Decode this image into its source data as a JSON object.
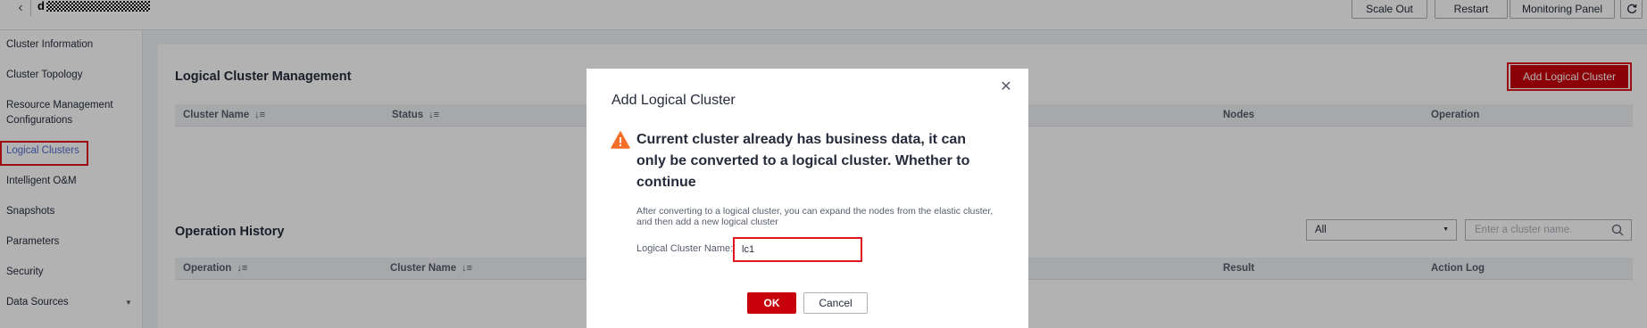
{
  "topbar": {
    "back_icon": "chevron-left-icon",
    "cluster_title_prefix": "d",
    "buttons": {
      "scale_out": "Scale Out",
      "restart": "Restart",
      "monitoring_panel": "Monitoring Panel",
      "refresh_icon": "refresh-icon"
    }
  },
  "sidebar": {
    "items": [
      {
        "label": "Cluster Information"
      },
      {
        "label": "Cluster Topology"
      },
      {
        "label": "Resource Management",
        "label2": "Configurations"
      },
      {
        "label": "Logical Clusters",
        "active": true
      },
      {
        "label": "Intelligent O&M"
      },
      {
        "label": "Snapshots"
      },
      {
        "label": "Parameters"
      },
      {
        "label": "Security"
      },
      {
        "label": "Data Sources",
        "expandable": true
      }
    ]
  },
  "main": {
    "logical_section": {
      "title": "Logical Cluster Management",
      "add_button": "Add Logical Cluster",
      "columns": [
        "Cluster Name",
        "Status",
        "Nodes",
        "Operation"
      ]
    },
    "history_section": {
      "title": "Operation History",
      "filter_selected": "All",
      "search_placeholder": "Enter a cluster name.",
      "columns": [
        "Operation",
        "Cluster Name",
        "Result",
        "Action Log"
      ]
    }
  },
  "dialog": {
    "title": "Add Logical Cluster",
    "warning": "Current cluster already has business data, it can only be converted to a logical cluster. Whether to continue",
    "description": "After converting to a logical cluster, you can expand the nodes from the elastic cluster, and then add a new logical cluster",
    "name_label": "Logical Cluster Name:",
    "name_value": "lc1",
    "ok": "OK",
    "cancel": "Cancel"
  },
  "colors": {
    "primary": "#c7000b",
    "highlight_border": "#e0161f",
    "warning": "#f66f29",
    "active_link": "#526ecc"
  }
}
